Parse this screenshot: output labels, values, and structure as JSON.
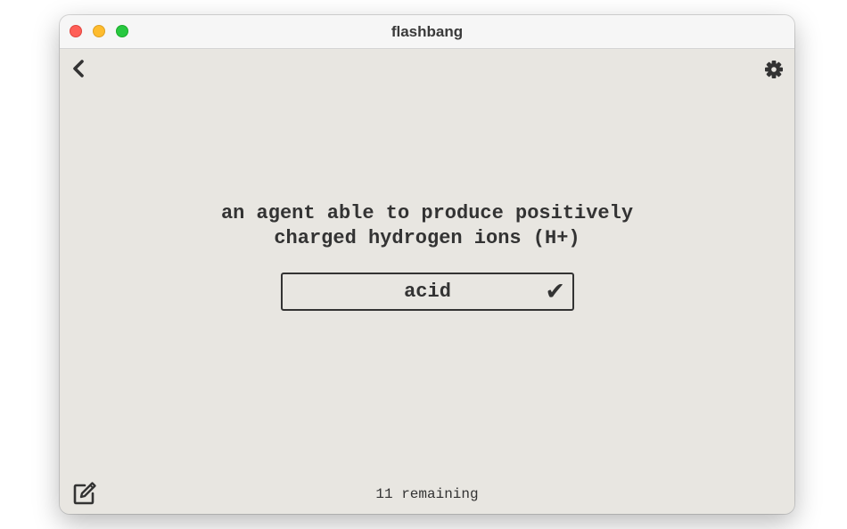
{
  "window": {
    "title": "flashbang",
    "controls": {
      "close_color": "#ff5f57",
      "minimize_color": "#febc2e",
      "zoom_color": "#28c840"
    }
  },
  "toolbar": {
    "back_icon": "chevron-left-icon",
    "settings_icon": "gear-icon",
    "edit_icon": "edit-icon"
  },
  "card": {
    "prompt_line1": "an agent able to produce positively",
    "prompt_line2": "charged hydrogen ions (H+)",
    "answer": "acid",
    "check_mark": "✔"
  },
  "footer": {
    "remaining": "11 remaining"
  },
  "colors": {
    "background": "#e8e6e1",
    "text": "#333333",
    "titlebar": "#f6f6f6"
  }
}
